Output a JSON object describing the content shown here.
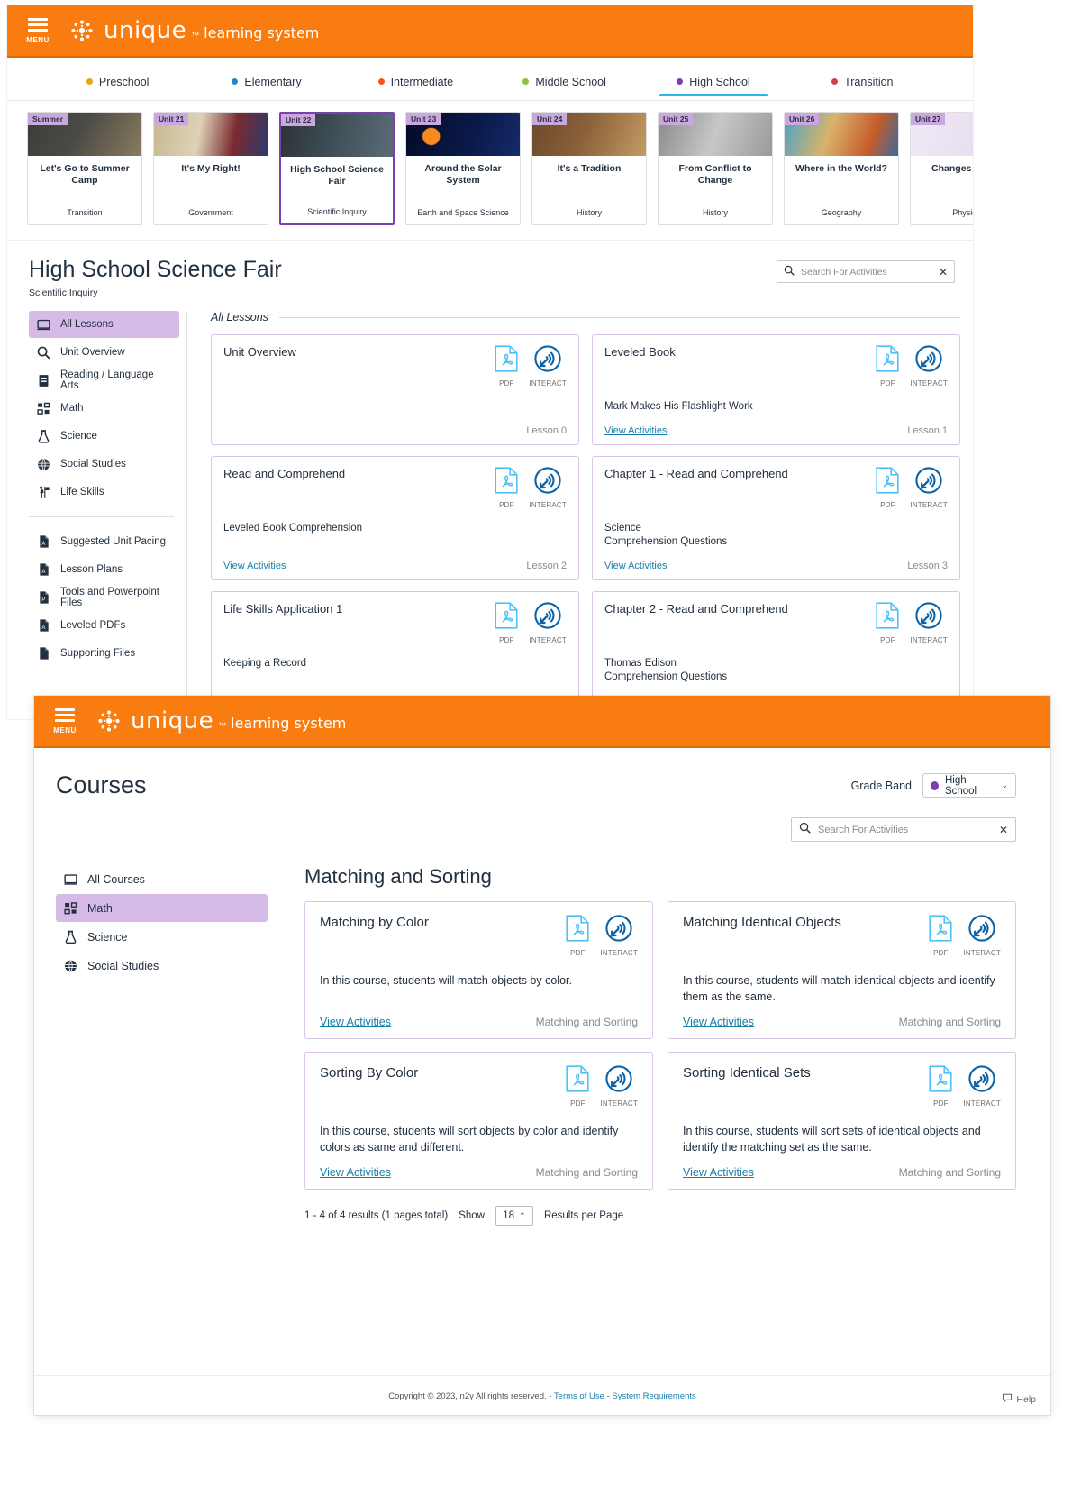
{
  "brand": {
    "name": "unique",
    "tm": "™",
    "tagline": "learning system",
    "menu_label": "MENU"
  },
  "window1": {
    "grade_tabs": [
      {
        "label": "Preschool",
        "color": "#e8a317",
        "active": false
      },
      {
        "label": "Elementary",
        "color": "#2e86c1",
        "active": false
      },
      {
        "label": "Intermediate",
        "color": "#f5541f",
        "active": false
      },
      {
        "label": "Middle School",
        "color": "#8bc34a",
        "active": false
      },
      {
        "label": "High School",
        "color": "#7a3fb0",
        "active": true
      },
      {
        "label": "Transition",
        "color": "#d64040",
        "active": false
      }
    ],
    "units": [
      {
        "badge": "Summer",
        "title": "Let's Go to Summer Camp",
        "subject": "Transition",
        "selected": false,
        "thumb": "summer-camp"
      },
      {
        "badge": "Unit 21",
        "title": "It's My Right!",
        "subject": "Government",
        "selected": false,
        "thumb": "constitution"
      },
      {
        "badge": "Unit 22",
        "title": "High School Science Fair",
        "subject": "Scientific Inquiry",
        "selected": true,
        "thumb": "science-lab"
      },
      {
        "badge": "Unit 23",
        "title": "Around the Solar System",
        "subject": "Earth and Space Science",
        "selected": false,
        "thumb": "solar-system"
      },
      {
        "badge": "Unit 24",
        "title": "It's a Tradition",
        "subject": "History",
        "selected": false,
        "thumb": "cookies"
      },
      {
        "badge": "Unit 25",
        "title": "From Conflict to Change",
        "subject": "History",
        "selected": false,
        "thumb": "tug-of-war"
      },
      {
        "badge": "Unit 26",
        "title": "Where in the World?",
        "subject": "Geography",
        "selected": false,
        "thumb": "travel-map"
      },
      {
        "badge": "Unit 27",
        "title": "Changes to Sou",
        "subject": "Physical",
        "selected": false,
        "thumb": "sound-wave"
      }
    ],
    "page_title": "High School Science Fair",
    "page_subtitle": "Scientific Inquiry",
    "search": {
      "placeholder": "Search For Activities",
      "value": "",
      "clear": "✕"
    },
    "sidebar_primary": [
      {
        "label": "All Lessons",
        "icon": "screen-icon",
        "active": true
      },
      {
        "label": "Unit Overview",
        "icon": "magnifier-icon",
        "active": false
      },
      {
        "label": "Reading / Language Arts",
        "icon": "book-icon",
        "active": false
      },
      {
        "label": "Math",
        "icon": "blocks-icon",
        "active": false
      },
      {
        "label": "Science",
        "icon": "flask-icon",
        "active": false
      },
      {
        "label": "Social Studies",
        "icon": "globe-icon",
        "active": false
      },
      {
        "label": "Life Skills",
        "icon": "person-flag-icon",
        "active": false
      }
    ],
    "sidebar_files": [
      {
        "label": "Suggested Unit Pacing",
        "icon": "pdf-file-icon"
      },
      {
        "label": "Lesson Plans",
        "icon": "pdf-file-icon"
      },
      {
        "label": "Tools and Powerpoint Files",
        "icon": "ppt-file-icon"
      },
      {
        "label": "Leveled PDFs",
        "icon": "pdf-file-icon"
      },
      {
        "label": "Supporting Files",
        "icon": "file-icon"
      }
    ],
    "lessons_heading": "All Lessons",
    "lesson_card_labels": {
      "pdf": "PDF",
      "interact": "INTERACT",
      "view": "View Activities"
    },
    "lessons": [
      {
        "title": "Unit Overview",
        "desc": "",
        "view": "",
        "num": "Lesson 0"
      },
      {
        "title": "Leveled Book",
        "desc": "Mark Makes His Flashlight Work",
        "view": "View Activities",
        "num": "Lesson 1"
      },
      {
        "title": "Read and Comprehend",
        "desc": "Leveled Book Comprehension",
        "view": "View Activities",
        "num": "Lesson 2"
      },
      {
        "title": "Chapter 1 - Read and Comprehend",
        "desc": "Science\nComprehension Questions",
        "view": "View Activities",
        "num": "Lesson 3"
      },
      {
        "title": "Life Skills Application 1",
        "desc": "Keeping a Record",
        "view": "",
        "num": ""
      },
      {
        "title": "Chapter 2 - Read and Comprehend",
        "desc": "Thomas Edison\nComprehension Questions",
        "view": "",
        "num": ""
      }
    ]
  },
  "window2": {
    "page_title": "Courses",
    "grade_band": {
      "label": "Grade Band",
      "value": "High School",
      "dot_color": "#7a3fb0",
      "chevron": "⌄"
    },
    "search": {
      "placeholder": "Search For Activities",
      "value": "",
      "clear": "✕"
    },
    "sidebar": [
      {
        "label": "All Courses",
        "icon": "screen-icon",
        "active": false
      },
      {
        "label": "Math",
        "icon": "blocks-icon",
        "active": true
      },
      {
        "label": "Science",
        "icon": "flask-icon",
        "active": false
      },
      {
        "label": "Social Studies",
        "icon": "globe-icon",
        "active": false
      }
    ],
    "section_title": "Matching and Sorting",
    "card_labels": {
      "pdf": "PDF",
      "interact": "INTERACT",
      "view": "View Activities"
    },
    "courses": [
      {
        "title": "Matching by Color",
        "desc": "In this course, students will match objects by color.",
        "view": "View Activities",
        "category": "Matching and Sorting"
      },
      {
        "title": "Matching Identical Objects",
        "desc": "In this course, students will match identical objects and identify them as the same.",
        "view": "View Activities",
        "category": "Matching and Sorting"
      },
      {
        "title": "Sorting By Color",
        "desc": "In this course, students will sort objects by color and identify colors as same and different.",
        "view": "View Activities",
        "category": "Matching and Sorting"
      },
      {
        "title": "Sorting Identical Sets",
        "desc": "In this course, students will sort sets of identical objects and identify the matching set as the same.",
        "view": "View Activities",
        "category": "Matching and Sorting"
      }
    ],
    "pager": {
      "results": "1 - 4 of 4 results (1 pages total)",
      "show": "Show",
      "per_page": "18",
      "per_page_suffix": "Results per Page",
      "stepper_arrow": "⌃"
    },
    "footer": {
      "copyright": "Copyright © 2023, n2y All rights reserved. -",
      "terms": "Terms of Use",
      "separator": "-",
      "requirements": "System Requirements",
      "help": "Help",
      "help_icon": "chat-icon"
    }
  },
  "colors": {
    "brand_orange": "#f87c0f",
    "accent_purple": "#7a3fb0",
    "link_blue": "#1a7fa8",
    "active_underline": "#29b6e8"
  }
}
